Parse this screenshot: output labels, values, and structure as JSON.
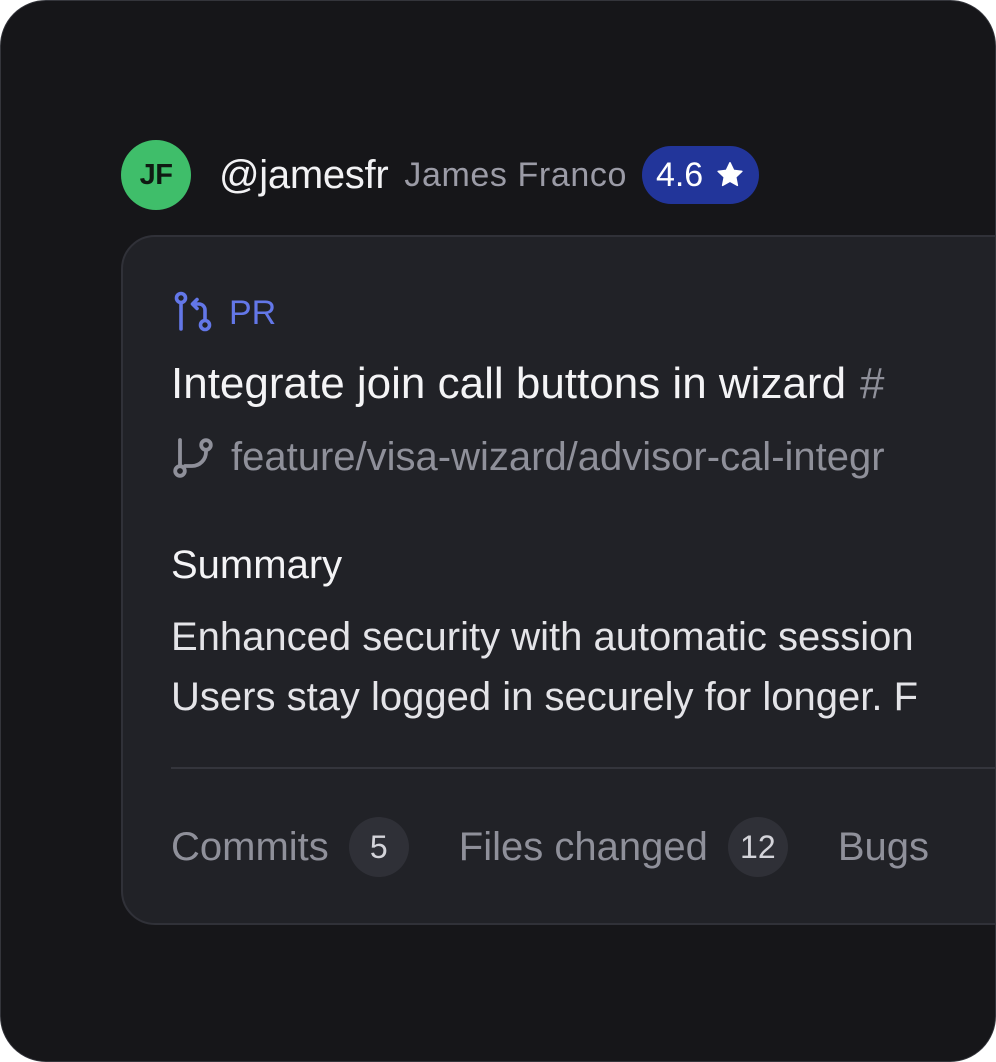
{
  "user": {
    "initials": "JF",
    "handle": "@jamesfr",
    "name": "James Franco",
    "rating": "4.6"
  },
  "pr": {
    "type_label": "PR",
    "title": "Integrate join call buttons in wizard",
    "number": "#",
    "branch": "feature/visa-wizard/advisor-cal-integr",
    "summary_heading": "Summary",
    "summary_lines": [
      "Enhanced security with automatic session",
      "Users stay logged in securely for longer. F"
    ],
    "stats": [
      {
        "label": "Commits",
        "count": "5"
      },
      {
        "label": "Files changed",
        "count": "12"
      },
      {
        "label": "Bugs",
        "count": ""
      }
    ]
  },
  "colors": {
    "background": "#161619",
    "card": "#212227",
    "avatar": "#3fbe6a",
    "rating_badge": "#22359a",
    "accent_pr": "#6377e8"
  },
  "icons": {
    "pr": "git-pull-request-icon",
    "branch": "git-branch-icon",
    "rating": "star-icon"
  }
}
